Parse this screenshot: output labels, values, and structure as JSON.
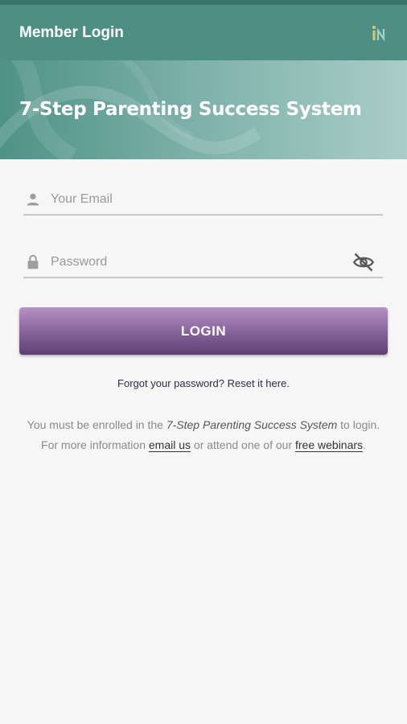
{
  "app_bar": {
    "title": "Member Login",
    "logo_icon": "brand-logo-icon"
  },
  "banner": {
    "title": "7-Step Parenting Success System"
  },
  "form": {
    "email": {
      "placeholder": "Your Email",
      "value": "",
      "icon": "person-icon"
    },
    "password": {
      "placeholder": "Password",
      "value": "",
      "icon": "lock-icon",
      "toggle_icon": "eye-off-icon"
    },
    "login_label": "LOGIN",
    "forgot_text": "Forgot your password? Reset it here."
  },
  "info": {
    "line1_prefix": "You must be enrolled in the ",
    "line1_emphasis": "7-Step Parenting Success System",
    "line1_suffix": " to login.",
    "line2_prefix": "For more information ",
    "email_link": "email us",
    "line2_middle": " or attend one of our ",
    "webinar_link": "free webinars",
    "line2_suffix": "."
  },
  "colors": {
    "app_bar": "#4d8f85",
    "status_strip": "#37746c",
    "button_top": "#b592c3",
    "button_bottom": "#5e3f74",
    "background": "#f6f6f6"
  }
}
